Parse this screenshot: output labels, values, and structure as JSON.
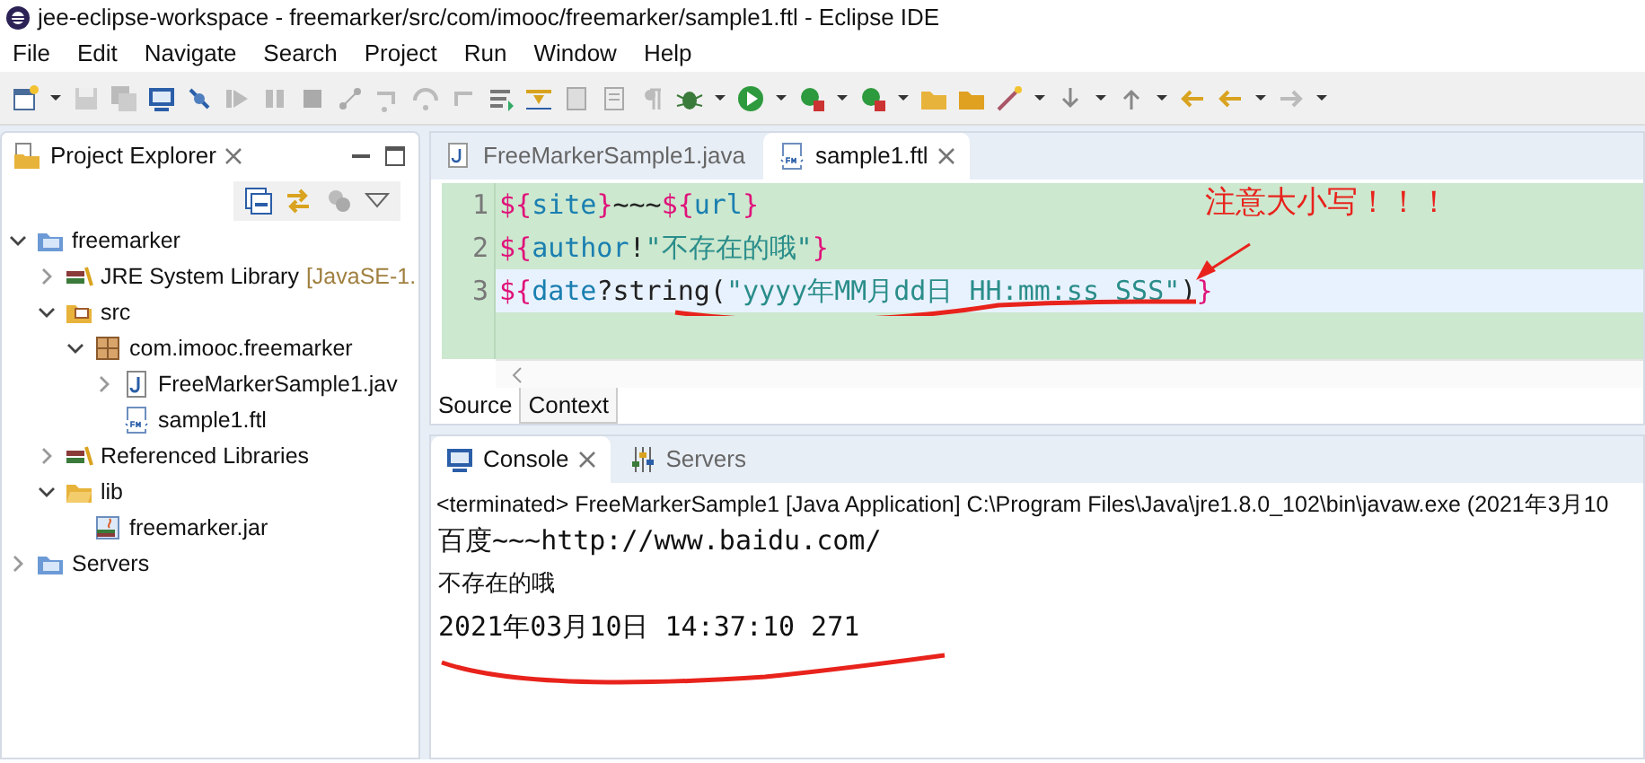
{
  "window": {
    "title": "jee-eclipse-workspace - freemarker/src/com/imooc/freemarker/sample1.ftl - Eclipse IDE"
  },
  "menu": [
    "File",
    "Edit",
    "Navigate",
    "Search",
    "Project",
    "Run",
    "Window",
    "Help"
  ],
  "explorer": {
    "title": "Project Explorer",
    "tree": [
      {
        "label": "freemarker",
        "kind": "project",
        "expanded": true,
        "children": [
          {
            "label": "JRE System Library",
            "suffix": "[JavaSE-1.",
            "kind": "library",
            "expanded": false
          },
          {
            "label": "src",
            "kind": "source-folder",
            "expanded": true,
            "children": [
              {
                "label": "com.imooc.freemarker",
                "kind": "package",
                "expanded": true,
                "children": [
                  {
                    "label": "FreeMarkerSample1.jav",
                    "kind": "java-file",
                    "expanded": false
                  },
                  {
                    "label": "sample1.ftl",
                    "kind": "ftl-file"
                  }
                ]
              }
            ]
          },
          {
            "label": "Referenced Libraries",
            "kind": "library",
            "expanded": false
          },
          {
            "label": "lib",
            "kind": "folder",
            "expanded": true,
            "children": [
              {
                "label": "freemarker.jar",
                "kind": "jar"
              }
            ]
          }
        ]
      },
      {
        "label": "Servers",
        "kind": "project",
        "expanded": false
      }
    ]
  },
  "editor": {
    "tabs": [
      {
        "label": "FreeMarkerSample1.java",
        "kind": "java",
        "selected": false
      },
      {
        "label": "sample1.ftl",
        "kind": "ftl",
        "selected": true
      }
    ],
    "lines": [
      {
        "number": "1",
        "current": false,
        "tokens": [
          {
            "text": "${",
            "kind": "delim"
          },
          {
            "text": "site",
            "kind": "name"
          },
          {
            "text": "}",
            "kind": "delim"
          },
          {
            "text": "~~~",
            "kind": "plain"
          },
          {
            "text": "${",
            "kind": "delim"
          },
          {
            "text": "url",
            "kind": "name"
          },
          {
            "text": "}",
            "kind": "delim"
          }
        ]
      },
      {
        "number": "2",
        "current": false,
        "tokens": [
          {
            "text": "${",
            "kind": "delim"
          },
          {
            "text": "author",
            "kind": "name"
          },
          {
            "text": "!",
            "kind": "plain"
          },
          {
            "text": "\"不存在的哦\"",
            "kind": "string"
          },
          {
            "text": "}",
            "kind": "delim"
          }
        ]
      },
      {
        "number": "3",
        "current": true,
        "tokens": [
          {
            "text": "${",
            "kind": "delim"
          },
          {
            "text": "date",
            "kind": "name"
          },
          {
            "text": "?string(",
            "kind": "plain"
          },
          {
            "text": "\"yyyy年MM月dd日 HH:mm:ss SSS\"",
            "kind": "string"
          },
          {
            "text": ")",
            "kind": "plain"
          },
          {
            "text": "}",
            "kind": "delim"
          }
        ]
      }
    ],
    "annotation": "注意大小写！！！",
    "bottom_tabs": [
      {
        "label": "Source",
        "selected": false
      },
      {
        "label": "Context",
        "selected": true
      }
    ]
  },
  "console": {
    "tabs": [
      {
        "label": "Console",
        "kind": "console",
        "selected": true
      },
      {
        "label": "Servers",
        "kind": "servers",
        "selected": false
      }
    ],
    "header": "<terminated> FreeMarkerSample1 [Java Application] C:\\Program Files\\Java\\jre1.8.0_102\\bin\\javaw.exe (2021年3月10",
    "lines": [
      "百度~~~http://www.baidu.com/",
      "不存在的哦",
      "2021年03月10日 14:37:10 271"
    ]
  }
}
